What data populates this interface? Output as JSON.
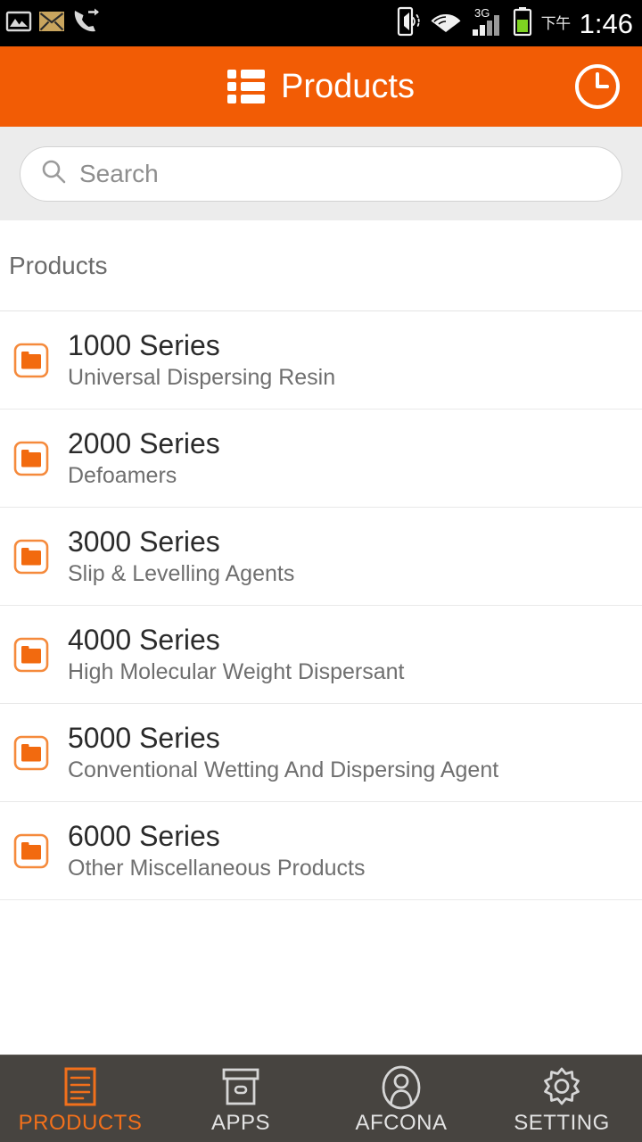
{
  "status_bar": {
    "left_icons": [
      "image-icon",
      "email-icon",
      "call-forward-icon"
    ],
    "right_icons": [
      "vibrate-icon",
      "wifi-icon",
      "signal-3g-icon",
      "battery-icon"
    ],
    "network_label": "3G",
    "am_pm": "下午",
    "time": "1:46"
  },
  "header": {
    "menu_icon": "list-icon",
    "title": "Products",
    "action_icon": "history-clock-icon"
  },
  "search": {
    "icon": "search-icon",
    "placeholder": "Search",
    "value": ""
  },
  "section": {
    "title": "Products"
  },
  "products": [
    {
      "icon": "folder-icon",
      "title": "1000 Series",
      "subtitle": "Universal Dispersing Resin"
    },
    {
      "icon": "folder-icon",
      "title": "2000 Series",
      "subtitle": "Defoamers"
    },
    {
      "icon": "folder-icon",
      "title": "3000 Series",
      "subtitle": "Slip & Levelling Agents"
    },
    {
      "icon": "folder-icon",
      "title": "4000 Series",
      "subtitle": "High Molecular Weight Dispersant"
    },
    {
      "icon": "folder-icon",
      "title": "5000 Series",
      "subtitle": "Conventional Wetting And Dispersing Agent"
    },
    {
      "icon": "folder-icon",
      "title": "6000 Series",
      "subtitle": "Other Miscellaneous Products"
    }
  ],
  "bottom_nav": {
    "items": [
      {
        "label": "PRODUCTS",
        "icon": "document-icon",
        "active": true
      },
      {
        "label": "APPS",
        "icon": "box-icon",
        "active": false
      },
      {
        "label": "AFCONA",
        "icon": "person-icon",
        "active": false
      },
      {
        "label": "SETTING",
        "icon": "gear-icon",
        "active": false
      }
    ]
  },
  "colors": {
    "accent_orange": "#f25c05",
    "nav_active_orange": "#f2701b",
    "nav_background": "#474440",
    "search_background": "#ececec",
    "status_bar": "#000000"
  }
}
